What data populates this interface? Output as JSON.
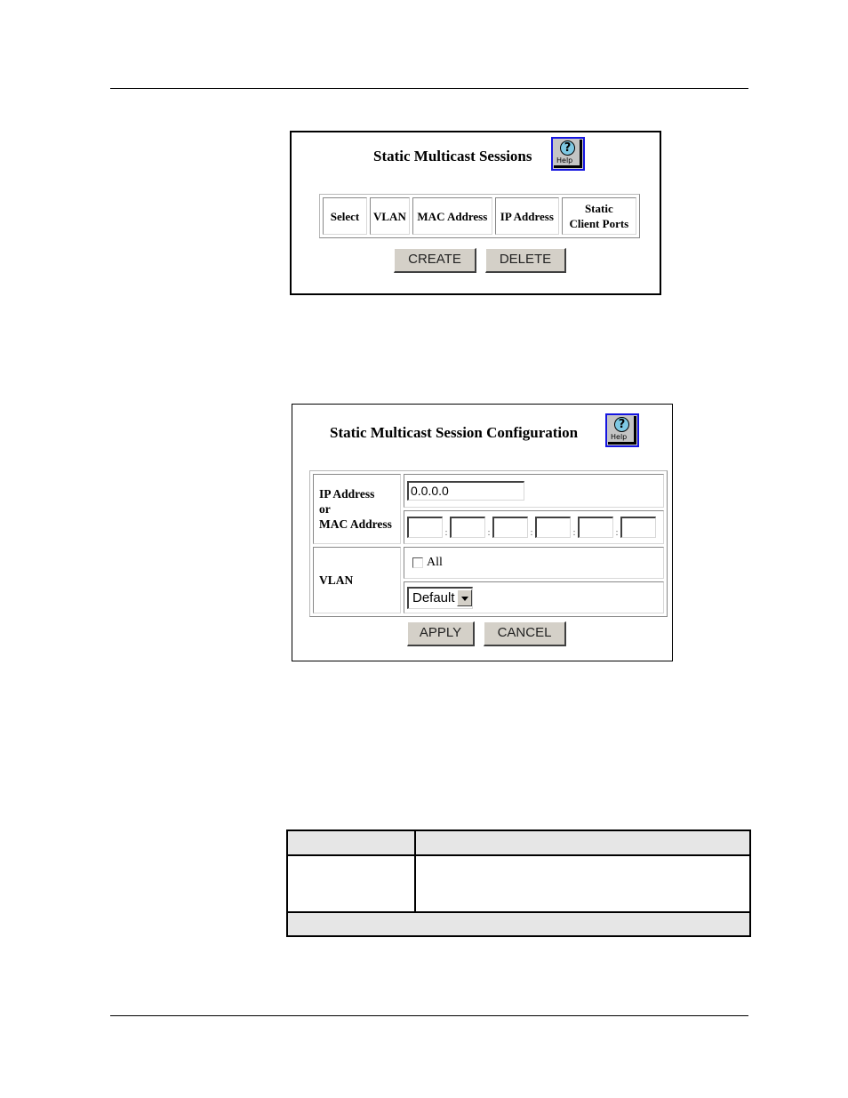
{
  "sessions_panel": {
    "title": "Static Multicast Sessions",
    "help_label": "Help",
    "columns": [
      "Select",
      "VLAN",
      "MAC Address",
      "IP Address",
      "Static Client Ports"
    ],
    "column_lines": {
      "static_client_ports": [
        "Static",
        "Client Ports"
      ]
    },
    "buttons": {
      "create": "CREATE",
      "delete": "DELETE"
    }
  },
  "config_panel": {
    "title": "Static Multicast Session Configuration",
    "help_label": "Help",
    "address_label": {
      "line1": "IP Address",
      "line2": "or",
      "line3": "MAC Address"
    },
    "ip_address_value": "0.0.0.0",
    "mac_octets": [
      "",
      "",
      "",
      "",
      "",
      ""
    ],
    "mac_separator": ":",
    "vlan_label": "VLAN",
    "all_checkbox": {
      "label": "All",
      "checked": false
    },
    "vlan_select_value": "Default",
    "buttons": {
      "apply": "APPLY",
      "cancel": "CANCEL"
    }
  },
  "doc_table": {
    "header": [
      "",
      ""
    ],
    "rows": [
      [
        "",
        ""
      ]
    ],
    "footer": ""
  }
}
